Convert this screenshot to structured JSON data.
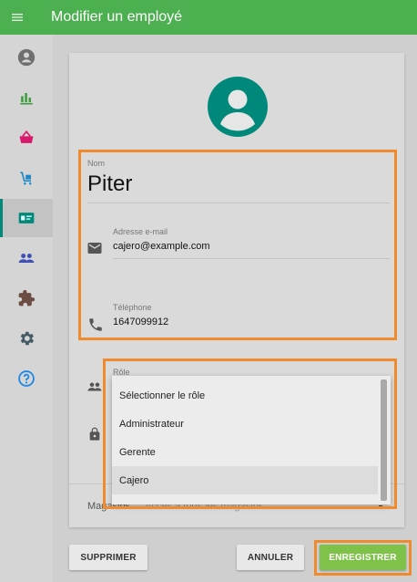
{
  "app": {
    "title": "Modifier un employé"
  },
  "colors": {
    "appbar": "#4caf50",
    "accent": "#00897b",
    "highlight_border": "#ef8a2e",
    "save_button": "#7fc24a"
  },
  "sidebar": {
    "items": [
      {
        "icon": "account-circle-icon"
      },
      {
        "icon": "bar-chart-icon"
      },
      {
        "icon": "basket-icon"
      },
      {
        "icon": "cart-icon"
      },
      {
        "icon": "badge-icon"
      },
      {
        "icon": "people-icon"
      },
      {
        "icon": "puzzle-icon"
      },
      {
        "icon": "gear-icon"
      },
      {
        "icon": "help-icon"
      }
    ],
    "active_index": 4
  },
  "form": {
    "name_label": "Nom",
    "name_value": "Piter",
    "email_label": "Adresse e-mail",
    "email_value": "cajero@example.com",
    "phone_label": "Téléphone",
    "phone_value": "1647099912",
    "role_label": "Rôle",
    "stores_label": "Magasins",
    "stores_value": "Accès à tous les magasins"
  },
  "role_dropdown": {
    "options": [
      "Sélectionner le rôle",
      "Administrateur",
      "Gerente",
      "Cajero"
    ],
    "highlighted": "Cajero"
  },
  "buttons": {
    "delete": "SUPPRIMER",
    "cancel": "ANNULER",
    "save": "ENREGISTRER"
  }
}
